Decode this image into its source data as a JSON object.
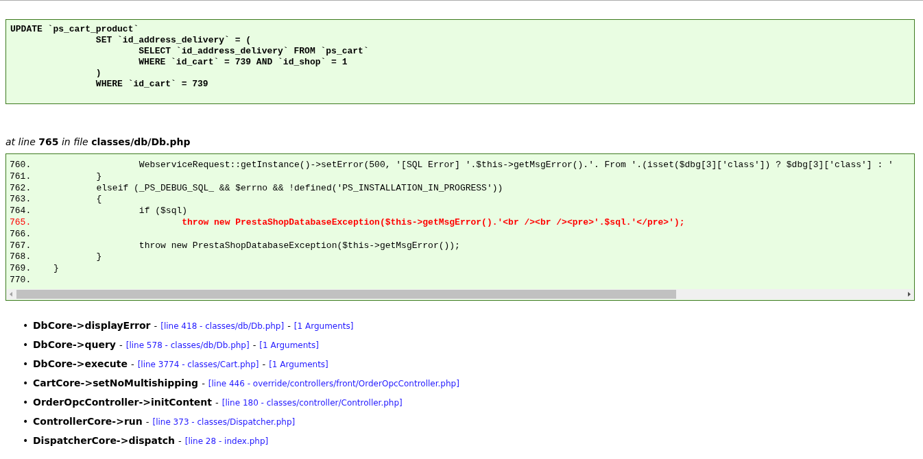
{
  "sql_box": {
    "lines": [
      "UPDATE `ps_cart_product`",
      "\t\tSET `id_address_delivery` = (",
      "\t\t\tSELECT `id_address_delivery` FROM `ps_cart`",
      "\t\t\tWHERE `id_cart` = 739 AND `id_shop` = 1",
      "\t\t)",
      "\t\tWHERE `id_cart` = 739"
    ]
  },
  "location": {
    "prefix": "at line",
    "line": "765",
    "middle": "in file",
    "file": "classes/db/Db.php"
  },
  "code_box": {
    "lines": [
      {
        "number": "760.",
        "text": "\t\tWebserviceRequest::getInstance()->setError(500, '[SQL Error] '.$this->getMsgError().'. From '.(isset($dbg[3]['class']) ? $dbg[3]['class'] : '",
        "highlighted": false
      },
      {
        "number": "761.",
        "text": "\t}",
        "highlighted": false
      },
      {
        "number": "762.",
        "text": "\telseif (_PS_DEBUG_SQL_ && $errno && !defined('PS_INSTALLATION_IN_PROGRESS'))",
        "highlighted": false
      },
      {
        "number": "763.",
        "text": "\t{",
        "highlighted": false
      },
      {
        "number": "764.",
        "text": "\t\tif ($sql)",
        "highlighted": false
      },
      {
        "number": "765.",
        "text": "\t\t\tthrow new PrestaShopDatabaseException($this->getMsgError().'<br /><br /><pre>'.$sql.'</pre>');",
        "highlighted": true
      },
      {
        "number": "766.",
        "highlighted": false
      },
      {
        "number": "767.",
        "text": "\t\tthrow new PrestaShopDatabaseException($this->getMsgError());",
        "highlighted": false
      },
      {
        "number": "768.",
        "text": "\t}",
        "highlighted": false
      },
      {
        "number": "769.",
        "text": "}",
        "highlighted": false
      },
      {
        "number": "770.",
        "highlighted": false
      }
    ]
  },
  "trace": [
    {
      "segments": [
        {
          "kind": "bullet",
          "text": "•"
        },
        {
          "kind": "call",
          "text": "DbCore->displayError"
        },
        {
          "kind": "dash",
          "text": "-"
        },
        {
          "kind": "link",
          "text": "[line 418 - classes/db/Db.php]"
        },
        {
          "kind": "dash",
          "text": "-"
        },
        {
          "kind": "link",
          "text": "[1 Arguments]"
        }
      ]
    },
    {
      "segments": [
        {
          "kind": "bullet",
          "text": "•"
        },
        {
          "kind": "call",
          "text": "DbCore->query"
        },
        {
          "kind": "dash",
          "text": "-"
        },
        {
          "kind": "link",
          "text": "[line 578 - classes/db/Db.php]"
        },
        {
          "kind": "dash",
          "text": "-"
        },
        {
          "kind": "link",
          "text": "[1 Arguments]"
        }
      ]
    },
    {
      "segments": [
        {
          "kind": "bullet",
          "text": "•"
        },
        {
          "kind": "call",
          "text": "DbCore->execute"
        },
        {
          "kind": "dash",
          "text": "-"
        },
        {
          "kind": "link",
          "text": "[line 3774 - classes/Cart.php]"
        },
        {
          "kind": "dash",
          "text": "-"
        },
        {
          "kind": "link",
          "text": "[1 Arguments]"
        }
      ]
    },
    {
      "segments": [
        {
          "kind": "bullet",
          "text": "•"
        },
        {
          "kind": "call",
          "text": "CartCore->setNoMultishipping"
        },
        {
          "kind": "dash",
          "text": "-"
        },
        {
          "kind": "link",
          "text": "[line 446 - override/controllers/front/OrderOpcController.php]"
        }
      ]
    },
    {
      "segments": [
        {
          "kind": "bullet",
          "text": "•"
        },
        {
          "kind": "call",
          "text": "OrderOpcController->initContent"
        },
        {
          "kind": "dash",
          "text": "-"
        },
        {
          "kind": "link",
          "text": "[line 180 - classes/controller/Controller.php]"
        }
      ]
    },
    {
      "segments": [
        {
          "kind": "bullet",
          "text": "•"
        },
        {
          "kind": "call",
          "text": "ControllerCore->run"
        },
        {
          "kind": "dash",
          "text": "-"
        },
        {
          "kind": "link",
          "text": "[line 373 - classes/Dispatcher.php]"
        }
      ]
    },
    {
      "segments": [
        {
          "kind": "bullet",
          "text": "•"
        },
        {
          "kind": "call",
          "text": "DispatcherCore->dispatch"
        },
        {
          "kind": "dash",
          "text": "-"
        },
        {
          "kind": "link",
          "text": "[line 28 - index.php]"
        }
      ]
    }
  ]
}
